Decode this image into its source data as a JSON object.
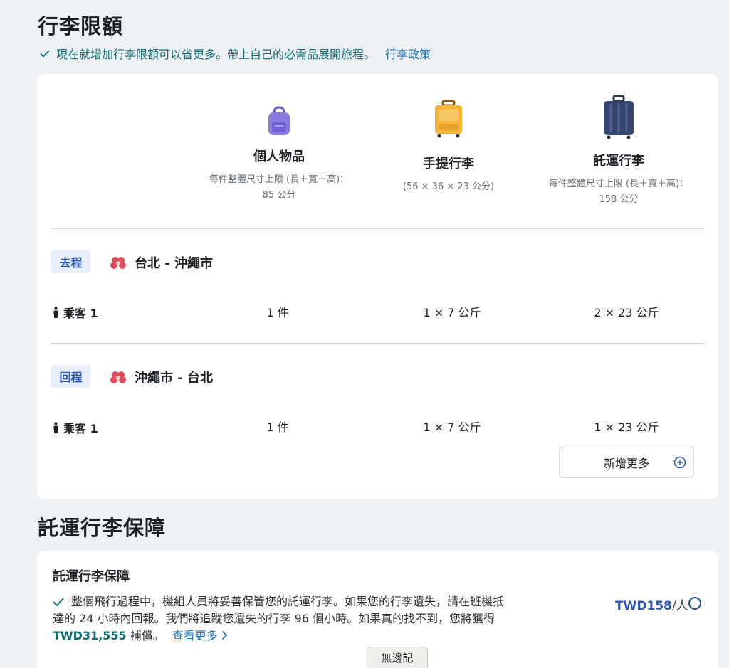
{
  "page": {
    "title": "行李限額",
    "promo_text": "現在就增加行李限額可以省更多。帶上自己的必需品展開旅程。",
    "policy_link": "行李政策"
  },
  "allowance": {
    "columns": [
      {
        "icon": "backpack-icon",
        "title": "個人物品",
        "desc1": "每件整體尺寸上限 (長＋寬＋高)：",
        "desc2": "85 公分"
      },
      {
        "icon": "carry-on-suitcase-icon",
        "title": "手提行李",
        "desc1": "(56 × 36 × 23 公分)",
        "desc2": ""
      },
      {
        "icon": "checked-suitcase-icon",
        "title": "託運行李",
        "desc1": "每件整體尺寸上限 (長＋寬＋高)：",
        "desc2": "158 公分"
      }
    ],
    "legs": [
      {
        "badge": "去程",
        "route": "台北 - 沖繩市",
        "passenger": "乘客 1",
        "personal": "1 件",
        "carry_on": "1 × 7 公斤",
        "checked": "2 × 23 公斤"
      },
      {
        "badge": "回程",
        "route": "沖繩市 - 台北",
        "passenger": "乘客 1",
        "personal": "1 件",
        "carry_on": "1 × 7 公斤",
        "checked": "1 × 23 公斤"
      }
    ],
    "add_more": "新增更多"
  },
  "protection": {
    "section_title": "託運行李保障",
    "card_title": "託運行李保障",
    "text_part1": "整個飛行過程中，機組人員將妥善保管您的託運行李。如果您的行李遺失，請在班機抵達的 24 小時內回報。我們將追蹤您遺失的行李 96 個小時。如果真的找不到，您將獲得",
    "compensation": "TWD31,555",
    "text_part2": "補償。",
    "see_more": "查看更多",
    "price": "TWD158",
    "per_person": "/人"
  },
  "tooltip": "無邊記",
  "colors": {
    "accent_blue": "#2a56b5",
    "teal": "#0f6b6b",
    "link": "#1b73b8"
  }
}
